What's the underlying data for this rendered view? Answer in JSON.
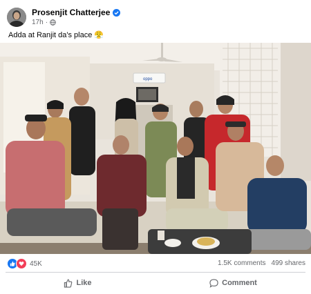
{
  "post": {
    "author": "Prosenjit Chatterjee",
    "time": "17h",
    "caption": "Adda at Ranjit da's place 😤"
  },
  "reactions": {
    "count": "45K",
    "comments": "1.5K comments",
    "shares": "499 shares"
  },
  "actions": {
    "like_label": "Like",
    "comment_label": "Comment"
  },
  "photo": {
    "tv_brand": "oppo"
  },
  "colors": {
    "brand_blue": "#1877f2",
    "love_red": "#f33e58",
    "text_secondary": "#65676b"
  }
}
